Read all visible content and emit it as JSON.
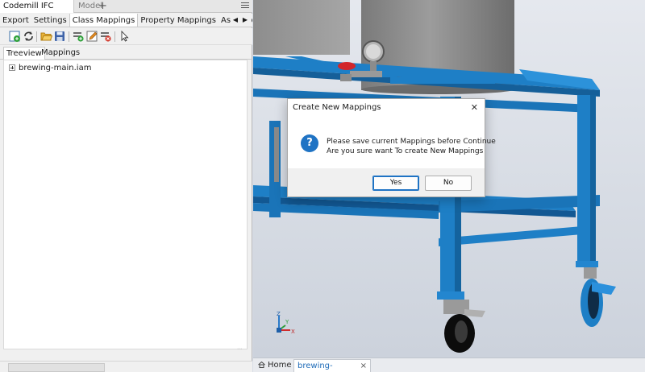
{
  "panel": {
    "tabs": [
      {
        "label": "Codemill IFC Exporter"
      },
      {
        "label": "Model"
      }
    ],
    "add_tab": "+",
    "subtabs": [
      "Export",
      "Settings",
      "Class Mappings",
      "Property Mappings",
      "Assembly Co"
    ],
    "active_subtab": "Class Mappings",
    "toolbar_icons": [
      "new-mapping-icon",
      "refresh-icon",
      "open-folder-icon",
      "save-icon",
      "add-row-icon",
      "edit-icon",
      "delete-icon",
      "select-cursor-icon"
    ],
    "view_tabs": [
      "Treeview",
      "Mappings"
    ],
    "tree": {
      "items": [
        {
          "label": "brewing-main.iam",
          "expanded": false
        }
      ]
    }
  },
  "document_tabs": {
    "home": "Home",
    "active": "brewing-main.iam"
  },
  "dialog": {
    "title": "Create New Mappings",
    "icon": "question-icon",
    "line1": "Please save current Mappings before Continue",
    "line2": "Are you sure want To create New Mappings",
    "yes": "Yes",
    "no": "No"
  },
  "colors": {
    "frame_blue": "#1e7fc6",
    "tank_gray": "#8c8c8c",
    "accent_blue": "#1f73c4"
  }
}
